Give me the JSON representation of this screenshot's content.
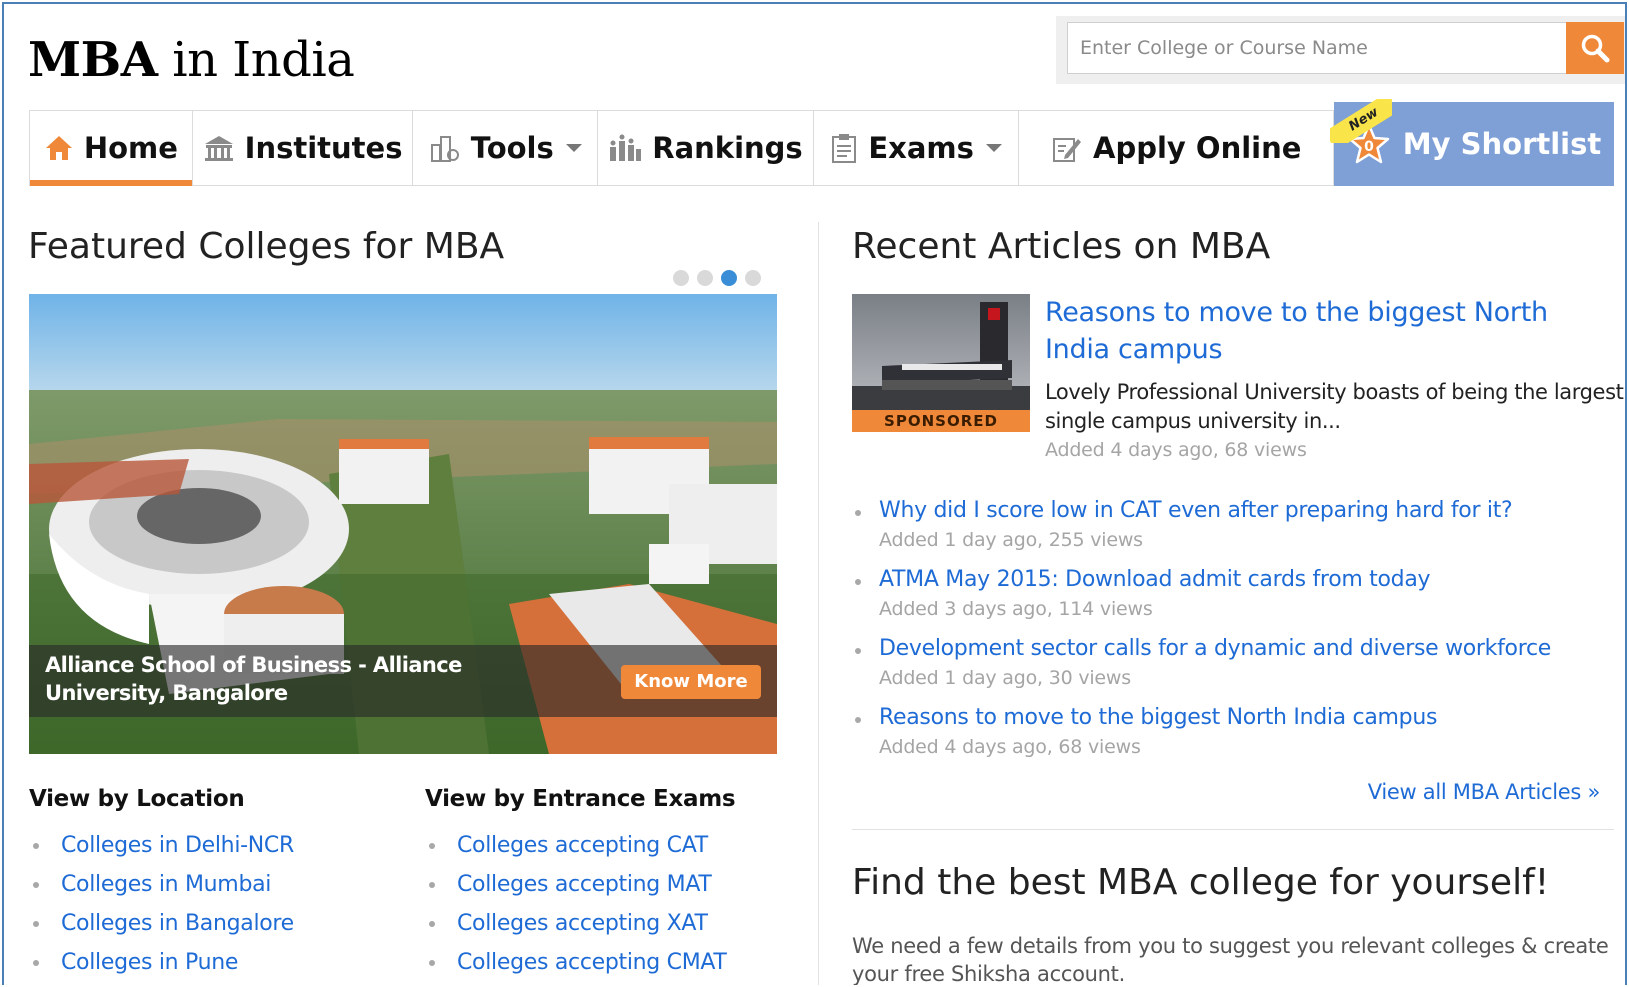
{
  "header": {
    "title_bold": "MBA",
    "title_rest": "in India",
    "search_placeholder": "Enter College or Course Name"
  },
  "nav": {
    "items": [
      {
        "label": "Home",
        "icon": "home-icon",
        "active": true
      },
      {
        "label": "Institutes",
        "icon": "institute-icon"
      },
      {
        "label": "Tools",
        "icon": "tools-icon",
        "dropdown": true
      },
      {
        "label": "Rankings",
        "icon": "rankings-icon"
      },
      {
        "label": "Exams",
        "icon": "exams-icon",
        "dropdown": true
      },
      {
        "label": "Apply Online",
        "icon": "apply-online-icon"
      }
    ],
    "shortlist": {
      "label": "My Shortlist",
      "count": "0",
      "badge": "New"
    }
  },
  "featured": {
    "heading": "Featured Colleges for MBA",
    "slides_total": 4,
    "active_slide": 3,
    "college_name": "Alliance School of Business - Alliance University, Bangalore",
    "cta": "Know More"
  },
  "by_location": {
    "heading": "View by Location",
    "links": [
      "Colleges in Delhi-NCR",
      "Colleges in Mumbai",
      "Colleges in Bangalore",
      "Colleges in Pune"
    ]
  },
  "by_exam": {
    "heading": "View by Entrance Exams",
    "links": [
      "Colleges accepting CAT",
      "Colleges accepting MAT",
      "Colleges accepting XAT",
      "Colleges accepting CMAT"
    ]
  },
  "articles": {
    "heading": "Recent Articles on MBA",
    "featured": {
      "title": "Reasons to move to the biggest North India campus",
      "description": "Lovely Professional University boasts of being the largest single campus university in...",
      "meta": "Added 4 days ago, 68 views",
      "badge": "SPONSORED"
    },
    "list": [
      {
        "title": "Why did I score low in CAT even after preparing hard for it?",
        "meta": "Added 1 day ago, 255 views"
      },
      {
        "title": "ATMA May 2015: Download admit cards from today",
        "meta": "Added 3 days ago, 114 views"
      },
      {
        "title": "Development sector calls for a dynamic and diverse workforce",
        "meta": "Added 1 day ago, 30 views"
      },
      {
        "title": "Reasons to move to the biggest North India campus",
        "meta": "Added 4 days ago, 68 views"
      }
    ],
    "view_all": "View all MBA Articles »"
  },
  "find": {
    "heading": "Find the best MBA college for yourself!",
    "description": "We need a few details from you to suggest you relevant colleges & create your free Shiksha account."
  },
  "colors": {
    "accent": "#f0883a",
    "link": "#1e6bd6",
    "shortlist": "#7f9fd7",
    "border": "#4a7fb8"
  }
}
